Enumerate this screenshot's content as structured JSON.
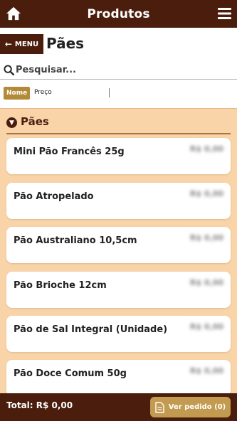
{
  "header": {
    "title": "Produtos"
  },
  "subheader": {
    "menu_label": "MENU",
    "page_title": "Pães"
  },
  "search": {
    "placeholder": "Pesquisar..."
  },
  "sort": {
    "active": "Nome",
    "other": "Preço"
  },
  "category": {
    "title": "Pães"
  },
  "products": [
    {
      "name": "Mini Pão Francês 25g",
      "price": "R$ 0,00"
    },
    {
      "name": "Pão Atropelado",
      "price": "R$ 0,00"
    },
    {
      "name": "Pão Australiano 10,5cm",
      "price": "R$ 0,00"
    },
    {
      "name": "Pão Brioche 12cm",
      "price": "R$ 0,00"
    },
    {
      "name": "Pão de Sal Integral (Unidade)",
      "price": "R$ 0,00"
    },
    {
      "name": "Pão Doce Comum 50g",
      "price": "R$ 0,00"
    }
  ],
  "footer": {
    "total": "Total: R$ 0,00",
    "order_button": "Ver pedido (0)"
  },
  "colors": {
    "primary": "#4a1d0d",
    "accent": "#c29a50",
    "background": "#f8d4a8"
  },
  "icons": {
    "home": "home-icon",
    "menu": "hamburger-icon",
    "search": "search-icon",
    "back": "arrow-left-icon",
    "collapse": "chevron-down-icon",
    "order": "document-icon"
  }
}
